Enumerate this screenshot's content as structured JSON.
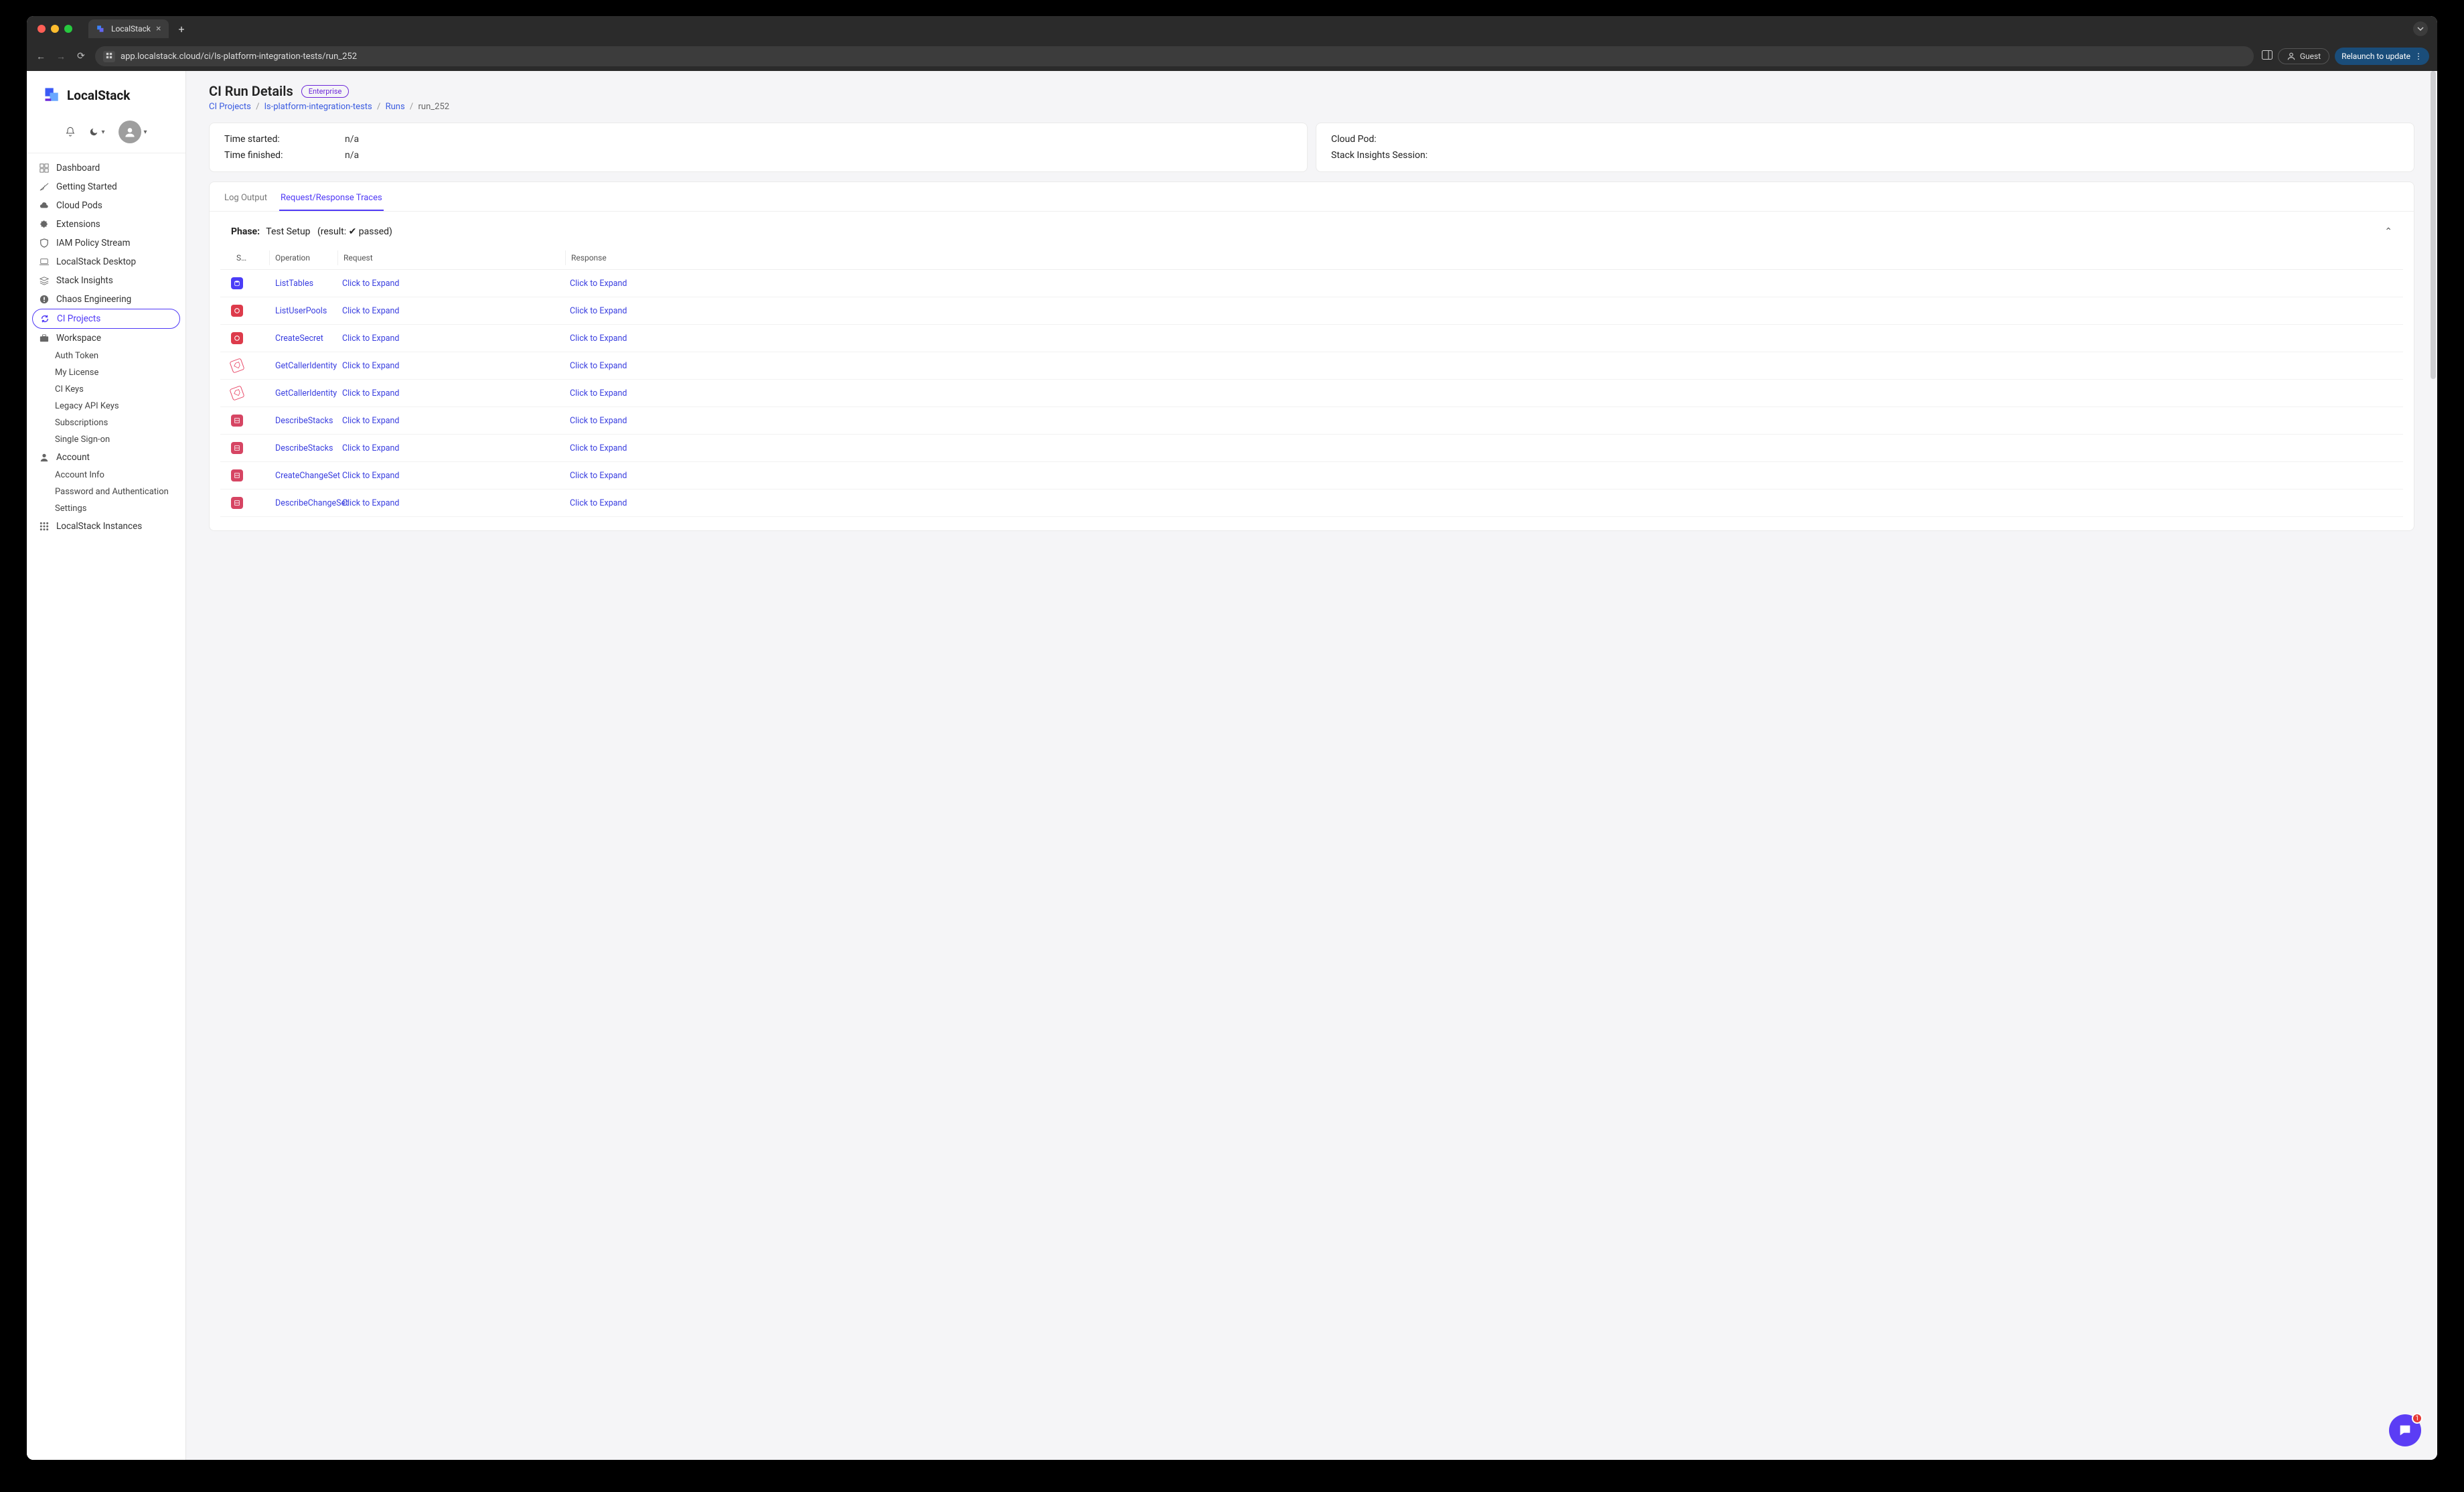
{
  "browser": {
    "tab_title": "LocalStack",
    "url": "app.localstack.cloud/ci/ls-platform-integration-tests/run_252",
    "guest_label": "Guest",
    "relaunch_label": "Relaunch to update"
  },
  "brand": {
    "name": "LocalStack"
  },
  "sidebar": {
    "items": [
      {
        "label": "Dashboard",
        "icon": "dashboard-icon"
      },
      {
        "label": "Getting Started",
        "icon": "plane-icon"
      },
      {
        "label": "Cloud Pods",
        "icon": "cloud-icon"
      },
      {
        "label": "Extensions",
        "icon": "puzzle-icon"
      },
      {
        "label": "IAM Policy Stream",
        "icon": "shield-icon"
      },
      {
        "label": "LocalStack Desktop",
        "icon": "laptop-icon"
      },
      {
        "label": "Stack Insights",
        "icon": "layers-icon"
      },
      {
        "label": "Chaos Engineering",
        "icon": "alert-icon"
      },
      {
        "label": "CI Projects",
        "icon": "refresh-icon",
        "active": true
      },
      {
        "label": "Workspace",
        "icon": "briefcase-icon"
      }
    ],
    "workspace_sub": [
      "Auth Token",
      "My License",
      "CI Keys",
      "Legacy API Keys",
      "Subscriptions",
      "Single Sign-on"
    ],
    "account_label": "Account",
    "account_sub": [
      "Account Info",
      "Password and Authentication",
      "Settings"
    ],
    "instances_label": "LocalStack Instances"
  },
  "page": {
    "title": "CI Run Details",
    "badge": "Enterprise",
    "breadcrumb": {
      "p1": "CI Projects",
      "p2": "ls-platform-integration-tests",
      "p3": "Runs",
      "p4": "run_252"
    }
  },
  "info": {
    "left": {
      "time_started_label": "Time started:",
      "time_started_val": "n/a",
      "time_finished_label": "Time finished:",
      "time_finished_val": "n/a"
    },
    "right": {
      "cloud_pod_label": "Cloud Pod:",
      "cloud_pod_val": "",
      "insights_label": "Stack Insights Session:",
      "insights_val": ""
    }
  },
  "tabs": {
    "log": "Log Output",
    "traces": "Request/Response Traces"
  },
  "phase": {
    "label": "Phase:",
    "name": "Test Setup",
    "result": "(result: ✔ passed)"
  },
  "table": {
    "headers": {
      "s": "S…",
      "op": "Operation",
      "req": "Request",
      "res": "Response"
    },
    "expand": "Click to Expand",
    "rows": [
      {
        "op": "ListTables",
        "svc": "blue"
      },
      {
        "op": "ListUserPools",
        "svc": "red"
      },
      {
        "op": "CreateSecret",
        "svc": "red"
      },
      {
        "op": "GetCallerIdentity",
        "svc": "tag"
      },
      {
        "op": "GetCallerIdentity",
        "svc": "tag"
      },
      {
        "op": "DescribeStacks",
        "svc": "pink"
      },
      {
        "op": "DescribeStacks",
        "svc": "pink"
      },
      {
        "op": "CreateChangeSet",
        "svc": "pink"
      },
      {
        "op": "DescribeChangeSet",
        "svc": "pink"
      }
    ]
  },
  "chat": {
    "count": "1"
  }
}
